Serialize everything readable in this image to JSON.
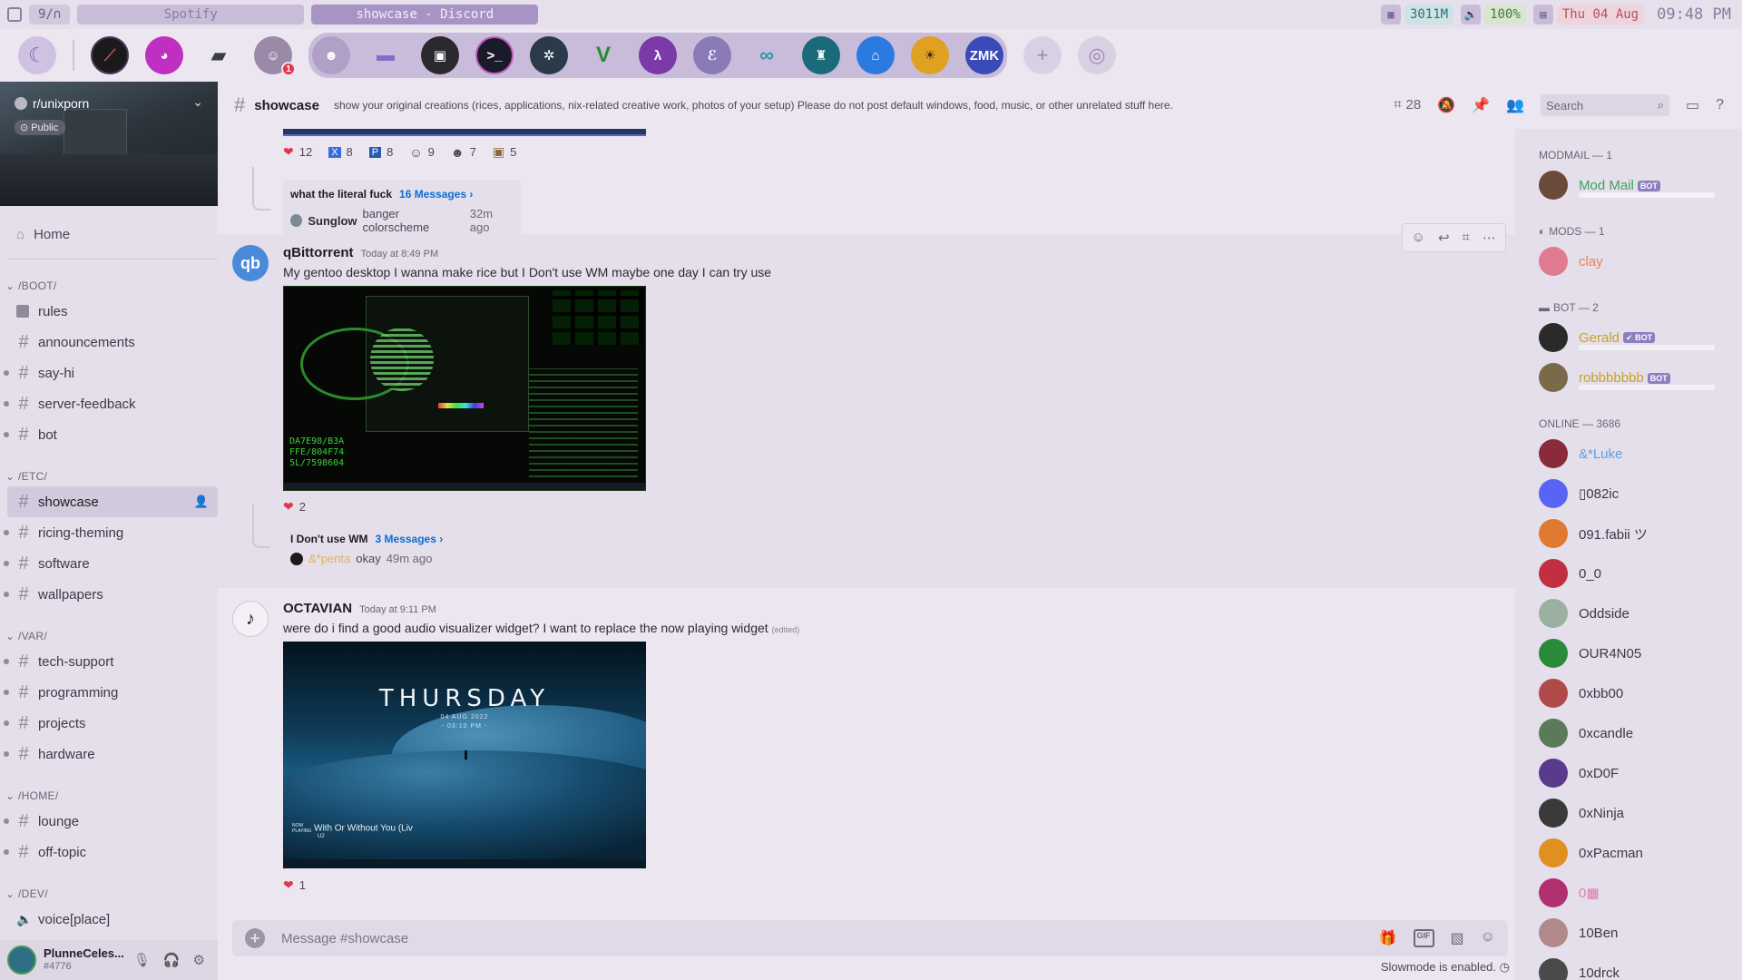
{
  "topbar": {
    "workspace": "9/∩",
    "windows": [
      "Spotify",
      "showcase - Discord"
    ],
    "memory": "3011M",
    "volume": "100%",
    "date": "Thu 04 Aug",
    "time": "09:48 PM"
  },
  "servers": {
    "badge_count": "1",
    "zmk_label": "ZMK"
  },
  "guild": {
    "name": "r/unixporn",
    "visibility": "Public",
    "home_label": "Home"
  },
  "channels": {
    "cat_boot": "/BOOT/",
    "rules": "rules",
    "announcements": "announcements",
    "say_hi": "say-hi",
    "server_feedback": "server-feedback",
    "bot": "bot",
    "cat_etc": "/ETC/",
    "showcase": "showcase",
    "ricing_theming": "ricing-theming",
    "software": "software",
    "wallpapers": "wallpapers",
    "cat_var": "/VAR/",
    "tech_support": "tech-support",
    "programming": "programming",
    "projects": "projects",
    "hardware": "hardware",
    "cat_home": "/HOME/",
    "lounge": "lounge",
    "off_topic": "off-topic",
    "cat_dev": "/DEV/",
    "voice_place": "voice[place]"
  },
  "user": {
    "name": "PlunneCeles...",
    "discriminator": "#4776"
  },
  "header": {
    "channel": "showcase",
    "topic": "show your original creations (rices, applications, nix-related creative work, photos of your setup) Please do not post default windows, food, music, or other unrelated stuff here.",
    "thread_count": "28",
    "search_placeholder": "Search"
  },
  "messages": {
    "prev_reactions": [
      {
        "emoji": "❤",
        "count": "12"
      },
      {
        "emoji": "X",
        "count": "8"
      },
      {
        "emoji": "P",
        "count": "8"
      },
      {
        "emoji": "☺",
        "count": "9"
      },
      {
        "emoji": "☻",
        "count": "7"
      },
      {
        "emoji": "▣",
        "count": "5"
      }
    ],
    "prev_thread": {
      "title": "what the literal fuck",
      "count": "16 Messages ›",
      "last_author": "Sunglow",
      "last_text": "banger colorscheme",
      "ago": "32m ago"
    },
    "m1": {
      "author": "qBittorrent",
      "timestamp": "Today at 8:49 PM",
      "text": "My gentoo desktop I wanna make rice but I Don't use WM maybe one day I can try use",
      "avatar_text": "qb",
      "image_hex": [
        "DA7E98/B3A",
        "FFE/804F74",
        "5L/7598604"
      ],
      "reaction_count": "2",
      "thread_title": "I Don't use WM",
      "thread_count": "3 Messages ›",
      "thread_author": "&*penta",
      "thread_text": "okay",
      "thread_ago": "49m ago"
    },
    "m2": {
      "author": "OCTAVIAN",
      "timestamp": "Today at 9:11 PM",
      "text": "were do i find a good audio visualizer widget? I want to replace the now playing widget",
      "edited": "(edited)",
      "image_title": "THURSDAY",
      "image_date": "04 AUG 2022",
      "image_time": "- 03:10 PM -",
      "image_np_label": "NOW PLAYING",
      "image_np_track": "With Or Without You (Liv",
      "image_np_artist": "U2",
      "reaction_count": "1"
    }
  },
  "composer": {
    "placeholder": "Message #showcase",
    "gif_label": "GIF",
    "slowmode": "Slowmode is enabled."
  },
  "members": {
    "groups": {
      "modmail": "MODMAIL — 1",
      "mods": "MODS — 1",
      "bot": "BOT — 2",
      "online": "ONLINE — 3686"
    },
    "modmail": [
      {
        "name": "Mod Mail",
        "color": "#3ba55c",
        "av": "#6b4a3a",
        "bot": "BOT"
      }
    ],
    "mods": [
      {
        "name": "clay",
        "color": "#f0824e",
        "av": "#e07a90"
      }
    ],
    "bots": [
      {
        "name": "Gerald",
        "color": "#c9a227",
        "av": "#2a2a2a",
        "bot": "✔ BOT"
      },
      {
        "name": "robbbbbbb",
        "color": "#c9a227",
        "av": "#7a6a4a",
        "bot": "BOT"
      }
    ],
    "online": [
      {
        "name": "&*Luke",
        "color": "#5a9ee0",
        "av": "#8a2a3a"
      },
      {
        "name": "▯082ic",
        "color": "#3e3848",
        "av": "#5865f2"
      },
      {
        "name": "091.fabii ツ",
        "color": "#3e3848",
        "av": "#e07a30"
      },
      {
        "name": "0_0",
        "color": "#3e3848",
        "av": "#c03040"
      },
      {
        "name": "Oddside",
        "color": "#3e3848",
        "av": "#9ab0a0"
      },
      {
        "name": "OUR4N05",
        "color": "#3e3848",
        "av": "#2a8a3a"
      },
      {
        "name": "0xbb00",
        "color": "#3e3848",
        "av": "#b04a4a"
      },
      {
        "name": "0xcandle",
        "color": "#3e3848",
        "av": "#5a7a5a"
      },
      {
        "name": "0xD0F",
        "color": "#3e3848",
        "av": "#5a3a8a"
      },
      {
        "name": "0xNinja",
        "color": "#3e3848",
        "av": "#3a3a3a"
      },
      {
        "name": "0xPacman",
        "color": "#3e3848",
        "av": "#e09020"
      },
      {
        "name": "0▦",
        "color": "#e07ab0",
        "av": "#b03070"
      },
      {
        "name": "10Ben",
        "color": "#3e3848",
        "av": "#b08a8a"
      },
      {
        "name": "10drck",
        "color": "#3e3848",
        "av": "#4a4a4a"
      }
    ]
  }
}
